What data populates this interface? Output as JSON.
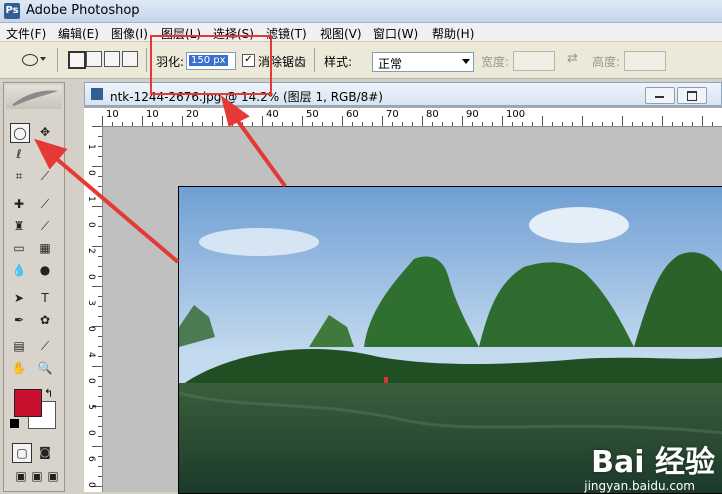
{
  "app": {
    "title": "Adobe Photoshop",
    "logo_text": "Ps"
  },
  "menu": [
    "文件(F)",
    "编辑(E)",
    "图像(I)",
    "图层(L)",
    "选择(S)",
    "滤镜(T)",
    "视图(V)",
    "窗口(W)",
    "帮助(H)"
  ],
  "options": {
    "feather_label": "羽化:",
    "feather_value": "150 px",
    "antialias_label": "消除锯齿",
    "antialias_checked": true,
    "style_label": "样式:",
    "style_value": "正常",
    "width_label": "宽度:",
    "height_label": "高度:",
    "swap_icon": "⇄"
  },
  "document": {
    "title": "ntk-1244-2676.jpg @ 14.2% (图层 1, RGB/8#)",
    "ruler_h": [
      "10",
      "10",
      "20",
      "30",
      "40",
      "50",
      "60",
      "70",
      "80",
      "90",
      "100"
    ],
    "ruler_v": [
      "1",
      "0",
      "1",
      "0",
      "2",
      "0",
      "3",
      "0",
      "4",
      "0",
      "5",
      "0",
      "6",
      "0"
    ]
  },
  "toolbox": {
    "foreground_color": "#c8102e",
    "background_color": "#ffffff"
  },
  "watermark": {
    "brand": "Bai 经验",
    "url": "jingyan.baidu.com"
  },
  "colors": {
    "highlight": "#e53935",
    "arrow": "#e53935"
  }
}
